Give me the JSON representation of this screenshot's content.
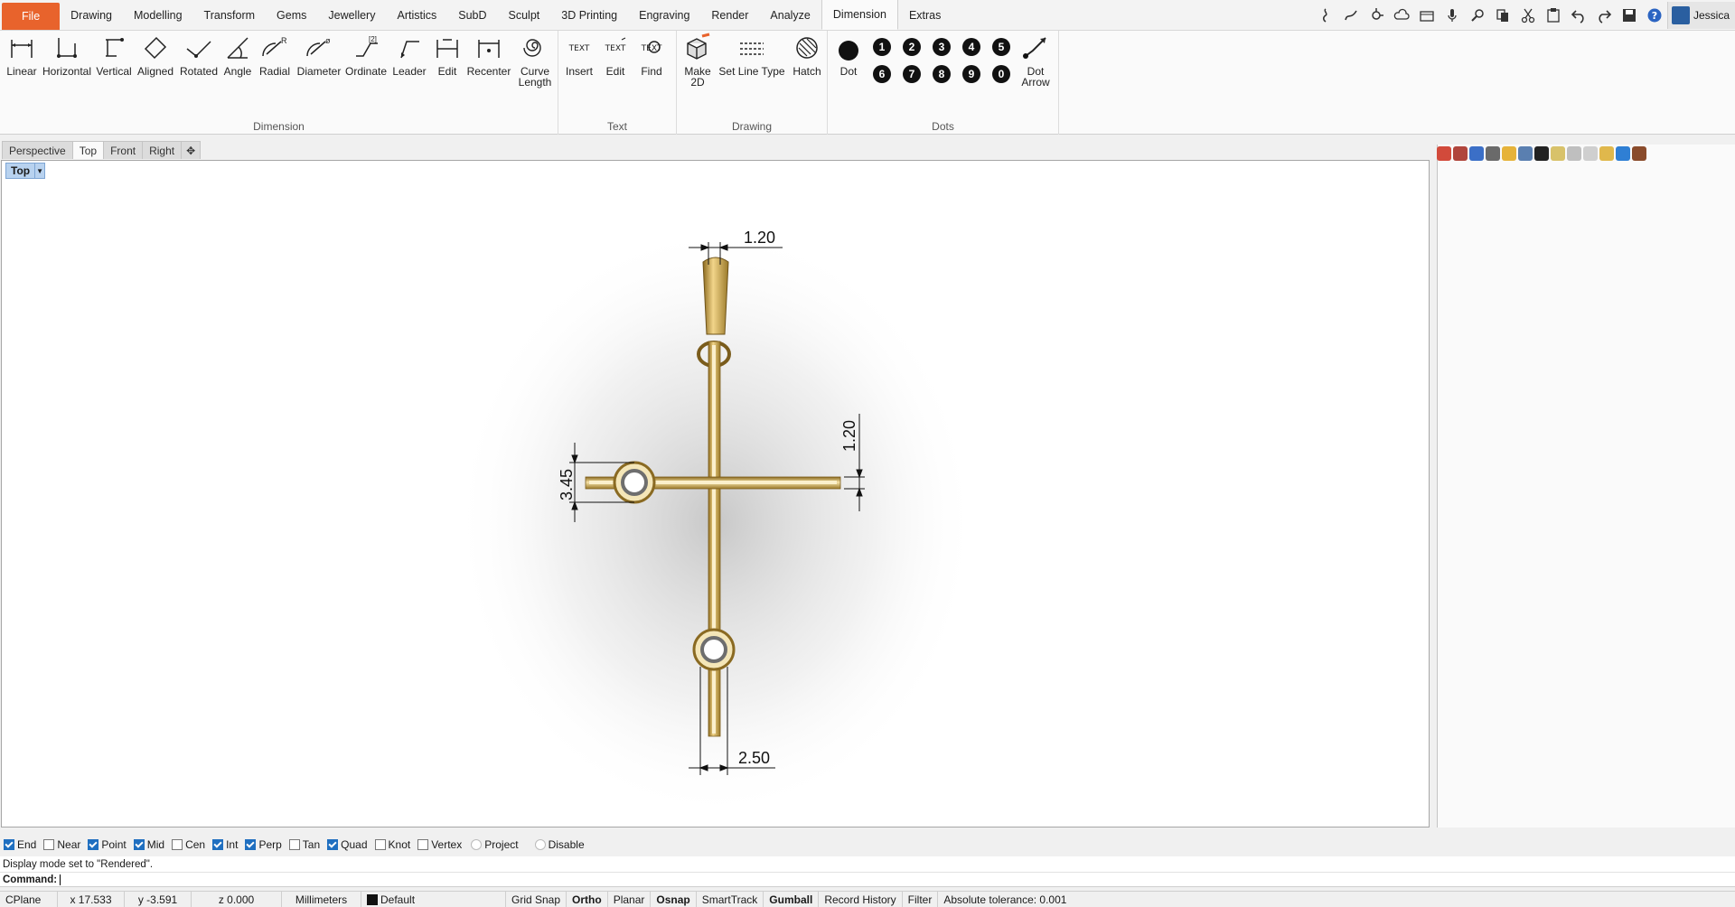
{
  "menubar": {
    "items": [
      "File",
      "Drawing",
      "Modelling",
      "Transform",
      "Gems",
      "Jewellery",
      "Artistics",
      "SubD",
      "Sculpt",
      "3D Printing",
      "Engraving",
      "Render",
      "Analyze",
      "Dimension",
      "Extras"
    ],
    "active": "Dimension",
    "user": "Jessica",
    "quick_icons": [
      "rhino-icon",
      "curve-icon",
      "gumball-icon",
      "cloud-icon",
      "camera-icon",
      "microphone-icon",
      "zoom-icon",
      "copy-icon",
      "cut-icon",
      "paste-icon",
      "undo-icon",
      "redo-icon",
      "save-icon",
      "help-icon"
    ]
  },
  "ribbon": {
    "dimension_group": {
      "label": "Dimension",
      "buttons": [
        "Linear",
        "Horizontal",
        "Vertical",
        "Aligned",
        "Rotated",
        "Angle",
        "Radial",
        "Diameter",
        "Ordinate",
        "Leader",
        "Edit",
        "Recenter",
        "Curve Length"
      ]
    },
    "text_group": {
      "label": "Text",
      "buttons": [
        "Insert",
        "Edit",
        "Find"
      ],
      "icon_text": "TEXT"
    },
    "drawing_group": {
      "label": "Drawing",
      "buttons": [
        "Make 2D",
        "Set Line Type",
        "Hatch"
      ]
    },
    "dots_group": {
      "label": "Dots",
      "buttons": [
        "Dot",
        "Dot Arrow"
      ],
      "numbers": [
        "1",
        "2",
        "3",
        "4",
        "5",
        "6",
        "7",
        "8",
        "9",
        "0"
      ]
    }
  },
  "viewport": {
    "tabs": [
      "Perspective",
      "Top",
      "Front",
      "Right"
    ],
    "active_tab": "Top",
    "label": "Top",
    "dimensions": [
      "1.20",
      "1.20",
      "3.45",
      "2.50"
    ]
  },
  "osnap": [
    {
      "label": "End",
      "checked": true
    },
    {
      "label": "Near",
      "checked": false
    },
    {
      "label": "Point",
      "checked": true
    },
    {
      "label": "Mid",
      "checked": true
    },
    {
      "label": "Cen",
      "checked": false
    },
    {
      "label": "Int",
      "checked": true
    },
    {
      "label": "Perp",
      "checked": true
    },
    {
      "label": "Tan",
      "checked": false
    },
    {
      "label": "Quad",
      "checked": true
    },
    {
      "label": "Knot",
      "checked": false
    },
    {
      "label": "Vertex",
      "checked": false
    },
    {
      "label": "Project",
      "checked": false
    },
    {
      "label": "Disable",
      "checked": false
    }
  ],
  "command": {
    "history": "Display mode set to \"Rendered\".",
    "prompt": "Command:"
  },
  "status": {
    "cplane": "CPlane",
    "x": "x 17.533",
    "y": "y -3.591",
    "z": "z 0.000",
    "units": "Millimeters",
    "layer": "Default",
    "toggles": [
      "Grid Snap",
      "Ortho",
      "Planar",
      "Osnap",
      "SmartTrack",
      "Gumball",
      "Record History",
      "Filter"
    ],
    "bold_toggles": [
      "Ortho",
      "Osnap",
      "Gumball"
    ],
    "tolerance": "Absolute tolerance: 0.001"
  },
  "colors": {
    "file_menu": "#e8632c",
    "gold": "#c9a44a",
    "check_blue": "#1f6fc0"
  }
}
